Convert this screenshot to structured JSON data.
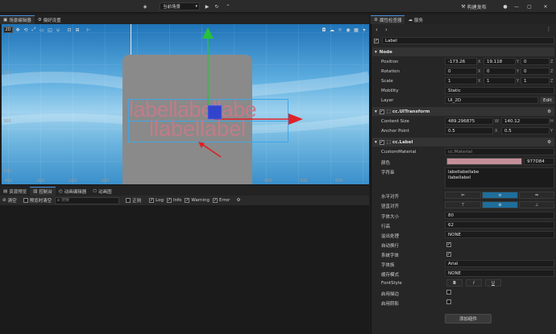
{
  "topbar": {
    "scene_select": "当前场景",
    "build_label": "构建发布"
  },
  "left_tabs": [
    {
      "label": "场景编辑器",
      "icon": "scene-icon"
    },
    {
      "label": "偏好设置",
      "icon": "gear-icon"
    }
  ],
  "right_tabs": [
    {
      "label": "属性检查器",
      "icon": "inspector-icon"
    },
    {
      "label": "服务",
      "icon": "cloud-icon"
    }
  ],
  "scene": {
    "mode": "2D",
    "label_text_top": "labellabellabe",
    "label_text_bottom": "llabellabel",
    "ruler_left": [
      "500",
      "300",
      "100"
    ],
    "ruler_bottom": [
      "-400",
      "-300",
      "-200",
      "-100",
      "400",
      "500",
      "600"
    ]
  },
  "bottom_tabs": [
    {
      "label": "资源预览",
      "icon": "preview-icon"
    },
    {
      "label": "控制台",
      "icon": "console-icon"
    },
    {
      "label": "动画编辑器",
      "icon": "animation-icon"
    },
    {
      "label": "动画图",
      "icon": "graph-icon"
    }
  ],
  "console": {
    "clear": "清空",
    "preview_clear": "预览时清空",
    "search_placeholder": "搜索",
    "regex": "正则",
    "log": "Log",
    "info": "Info",
    "warning": "Warning",
    "error": "Error"
  },
  "inspector": {
    "node_name": "Label",
    "node_section": "Node",
    "position": {
      "label": "Position",
      "x": "-173.26",
      "y": "19.118",
      "z": "0"
    },
    "rotation": {
      "label": "Rotation",
      "x": "0",
      "y": "0",
      "z": "0"
    },
    "scale": {
      "label": "Scale",
      "x": "1",
      "y": "1",
      "z": "1"
    },
    "mobility": {
      "label": "Mobility",
      "value": "Static"
    },
    "layer": {
      "label": "Layer",
      "value": "UI_2D",
      "edit": "Edit"
    },
    "uitransform": {
      "title": "cc.UITransform",
      "content_size": {
        "label": "Content Size",
        "w": "489.296875",
        "h": "140.12"
      },
      "anchor": {
        "label": "Anchor Point",
        "x": "0.5",
        "y": "0.5"
      }
    },
    "label_comp": {
      "title": "cc.Label",
      "custom_material": {
        "label": "CustomMaterial",
        "value": "cc.Material"
      },
      "color": {
        "label": "颜色",
        "hex": "977D84",
        "swatch": "#c48f98"
      },
      "string": {
        "label": "字符串",
        "line1": "labellabellabe",
        "line2": "llabellabel"
      },
      "h_align": "水平对齐",
      "v_align": "竖直对齐",
      "font_size": {
        "label": "字体大小",
        "value": "80"
      },
      "line_height": {
        "label": "行高",
        "value": "62"
      },
      "overflow": {
        "label": "溢出处理",
        "value": "NONE"
      },
      "wrap": "自动换行",
      "system_font": "系统字体",
      "font_family": {
        "label": "字体族",
        "value": "Arial"
      },
      "cache_mode": {
        "label": "缓存模式",
        "value": "NONE"
      },
      "font_style": {
        "label": "FontStyle",
        "b": "B",
        "i": "I",
        "u": "U"
      },
      "underline": "启用描边",
      "shadow": "启用阴影"
    },
    "add_component": "添加组件"
  }
}
